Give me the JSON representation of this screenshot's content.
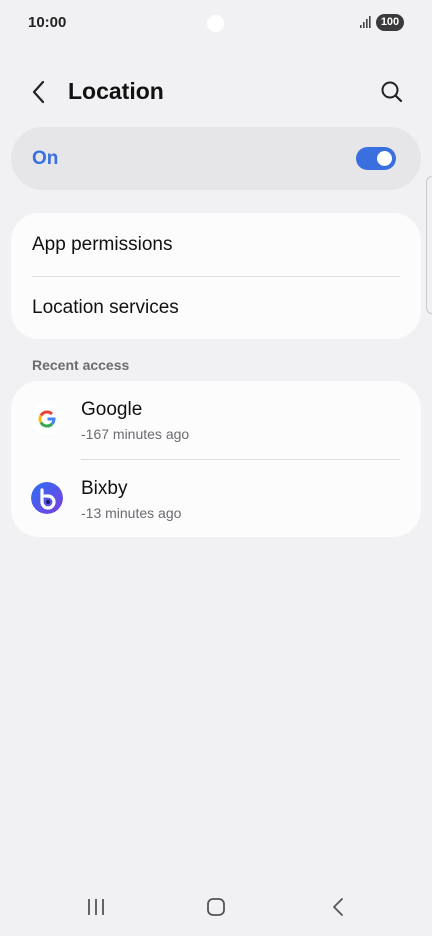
{
  "status_bar": {
    "time": "10:00",
    "battery": "100",
    "signal_icon": "signal-bars-icon"
  },
  "header": {
    "title": "Location",
    "back_icon": "chevron-left-icon",
    "search_icon": "search-icon"
  },
  "master_switch": {
    "label": "On",
    "state": true,
    "accent": "#3a6fe0"
  },
  "settings": {
    "items": [
      {
        "label": "App permissions"
      },
      {
        "label": "Location services"
      }
    ]
  },
  "recent_access": {
    "header": "Recent access",
    "items": [
      {
        "name": "Google",
        "time": "-167 minutes ago",
        "icon": "google-logo-icon"
      },
      {
        "name": "Bixby",
        "time": "-13 minutes ago",
        "icon": "bixby-logo-icon"
      }
    ]
  },
  "nav_bar": {
    "recents_icon": "recents-icon",
    "home_icon": "home-icon",
    "back_icon": "back-icon"
  }
}
